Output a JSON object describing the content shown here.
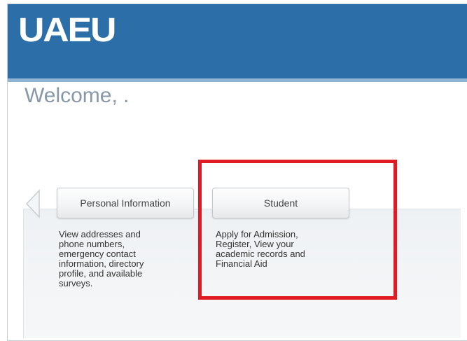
{
  "header": {
    "logo_text": "UAEU",
    "background_color": "#2c6fa8"
  },
  "welcome": {
    "text": "Welcome, ."
  },
  "nav": {
    "prev_icon": "chevron-left-icon",
    "tabs": [
      {
        "label": "Personal Information",
        "description": "View addresses and\nphone numbers,\nemergency contact\ninformation, directory\nprofile, and available\nsurveys."
      },
      {
        "label": "Student",
        "description": "Apply for Admission,\nRegister, View your\nacademic records and\nFinancial Aid"
      }
    ]
  },
  "annotation": {
    "highlight_color": "#e01b24"
  }
}
